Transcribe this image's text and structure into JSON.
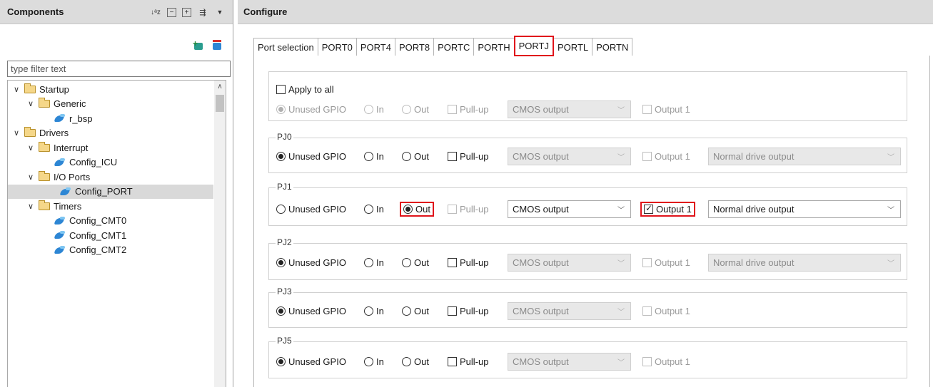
{
  "left": {
    "title": "Components",
    "filter_placeholder": "type filter text",
    "tree": [
      {
        "label": "Startup",
        "type": "folder",
        "level": 0
      },
      {
        "label": "Generic",
        "type": "folder",
        "level": 1
      },
      {
        "label": "r_bsp",
        "type": "leaf",
        "level": 2
      },
      {
        "label": "Drivers",
        "type": "folder",
        "level": 0
      },
      {
        "label": "Interrupt",
        "type": "folder",
        "level": 1
      },
      {
        "label": "Config_ICU",
        "type": "leaf",
        "level": 2
      },
      {
        "label": "I/O Ports",
        "type": "folder",
        "level": 1
      },
      {
        "label": "Config_PORT",
        "type": "leaf",
        "level": 2,
        "selected": true
      },
      {
        "label": "Timers",
        "type": "folder",
        "level": 1
      },
      {
        "label": "Config_CMT0",
        "type": "leaf",
        "level": 2
      },
      {
        "label": "Config_CMT1",
        "type": "leaf",
        "level": 2
      },
      {
        "label": "Config_CMT2",
        "type": "leaf",
        "level": 2
      }
    ]
  },
  "right": {
    "title": "Configure",
    "tabs": [
      "Port selection",
      "PORT0",
      "PORT4",
      "PORT8",
      "PORTC",
      "PORTH",
      "PORTJ",
      "PORTL",
      "PORTN"
    ],
    "active_tab": "PORTJ",
    "apply_all": {
      "label": "Apply to all",
      "unused": "Unused GPIO",
      "in": "In",
      "out": "Out",
      "pullup": "Pull-up",
      "output_type": "CMOS output",
      "output1": "Output 1"
    },
    "pins": [
      {
        "name": "PJ0",
        "unused": "Unused GPIO",
        "in": "In",
        "out": "Out",
        "pullup": "Pull-up",
        "output_type": "CMOS output",
        "output1": "Output 1",
        "drive": "Normal drive output"
      },
      {
        "name": "PJ1",
        "unused": "Unused GPIO",
        "in": "In",
        "out": "Out",
        "pullup": "Pull-up",
        "output_type": "CMOS output",
        "output1": "Output 1",
        "drive": "Normal drive output"
      },
      {
        "name": "PJ2",
        "unused": "Unused GPIO",
        "in": "In",
        "out": "Out",
        "pullup": "Pull-up",
        "output_type": "CMOS output",
        "output1": "Output 1",
        "drive": "Normal drive output"
      },
      {
        "name": "PJ3",
        "unused": "Unused GPIO",
        "in": "In",
        "out": "Out",
        "pullup": "Pull-up",
        "output_type": "CMOS output",
        "output1": "Output 1"
      },
      {
        "name": "PJ5",
        "unused": "Unused GPIO",
        "in": "In",
        "out": "Out",
        "pullup": "Pull-up",
        "output_type": "CMOS output",
        "output1": "Output 1"
      }
    ]
  },
  "colors": {
    "highlight": "#e0141b",
    "header_bg": "#dcdcdc",
    "selected_row": "#d9d9d9"
  }
}
